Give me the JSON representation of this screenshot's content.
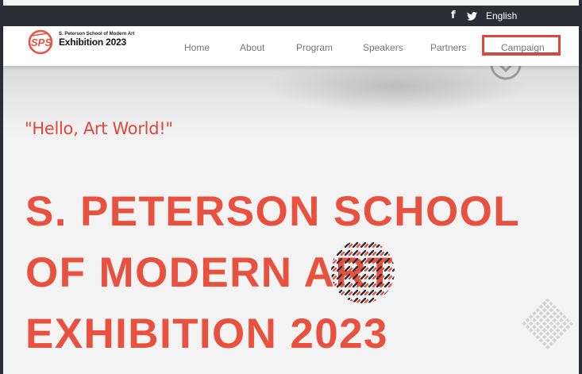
{
  "topbar": {
    "facebook_icon": "f",
    "language": "English"
  },
  "navbar": {
    "logo_mark": "SPS",
    "logo_subtitle": "S. Peterson School of Modern Art",
    "logo_title": "Exhibition 2023",
    "items": [
      {
        "label": "Home"
      },
      {
        "label": "About"
      },
      {
        "label": "Program"
      },
      {
        "label": "Speakers"
      },
      {
        "label": "Partners"
      },
      {
        "label": "Campaign",
        "highlighted": true
      }
    ]
  },
  "hero": {
    "tagline": "\"Hello, Art World!\"",
    "headline_lines": [
      "S. PETERSON SCHOOL",
      "OF MODERN ART",
      "EXHIBITION 2023"
    ]
  },
  "colors": {
    "accent": "#e8503f",
    "topbar": "#2b2e35",
    "nav_text": "#777777"
  }
}
